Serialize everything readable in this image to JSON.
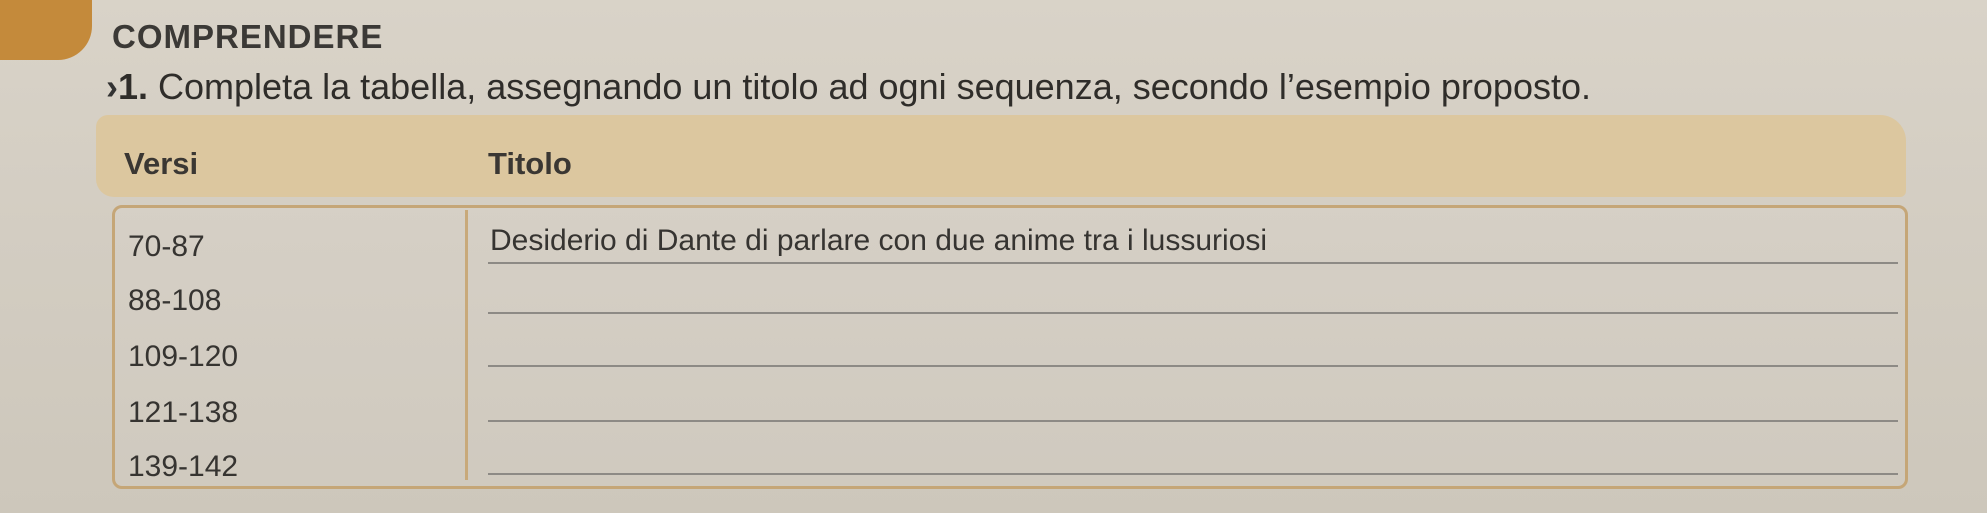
{
  "section": {
    "heading": "COMPRENDERE"
  },
  "exercise": {
    "marker": "›",
    "number": "1.",
    "instruction": "Completa la tabella, assegnando un titolo ad ogni sequenza, secondo l’esempio proposto."
  },
  "table": {
    "headers": {
      "verses": "Versi",
      "title": "Titolo"
    },
    "rows": [
      {
        "verses": "70-87",
        "title": "Desiderio di Dante di parlare con due anime tra i lussuriosi"
      },
      {
        "verses": "88-108",
        "title": ""
      },
      {
        "verses": "109-120",
        "title": ""
      },
      {
        "verses": "121-138",
        "title": ""
      },
      {
        "verses": "139-142",
        "title": ""
      }
    ]
  },
  "colors": {
    "tab_marker": "#c48a3b",
    "header_band": "#dcc79f",
    "table_border": "#c5a677"
  }
}
